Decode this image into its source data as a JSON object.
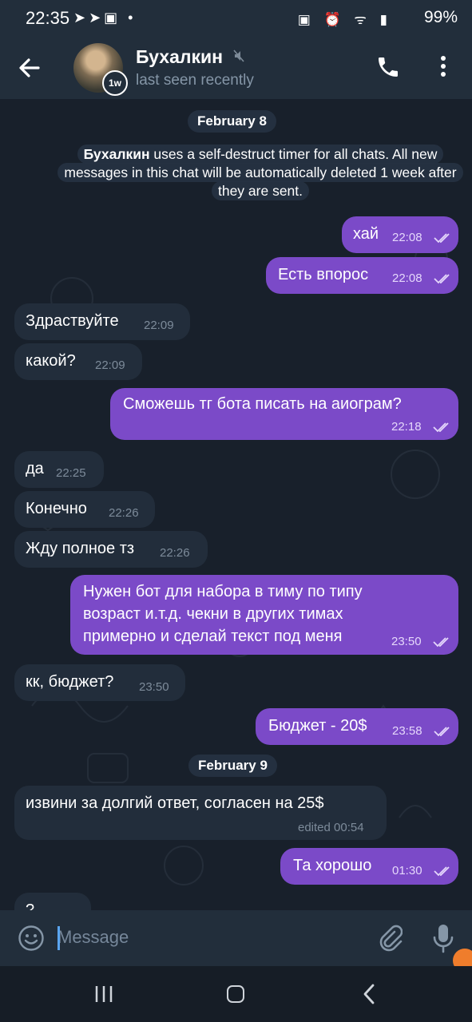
{
  "status_bar": {
    "time": "22:35",
    "battery": "99%",
    "left_icons": "➤➤▣ •",
    "right_icons": "▣ ⏰ ᯤ ▮"
  },
  "header": {
    "title": "Бухалкин",
    "subtitle": "last seen recently",
    "timer_badge": "1w"
  },
  "chat": {
    "date_1": "February 8",
    "service_name": "Бухалкин",
    "service_text": " uses a self-destruct timer for all chats. All new messages in this chat will be automatically deleted 1 week after they are sent.",
    "date_2": "February 9",
    "messages": [
      {
        "dir": "out",
        "text": "хай",
        "time": "22:08"
      },
      {
        "dir": "out",
        "text": "Есть впорос",
        "time": "22:08"
      },
      {
        "dir": "in",
        "text": "Здраствуйте",
        "time": "22:09"
      },
      {
        "dir": "in",
        "text": "какой?",
        "time": "22:09"
      },
      {
        "dir": "out",
        "text": "Сможешь тг бота писать на аиограм?",
        "time": "22:18"
      },
      {
        "dir": "in",
        "text": "да",
        "time": "22:25"
      },
      {
        "dir": "in",
        "text": "Конечно",
        "time": "22:26"
      },
      {
        "dir": "in",
        "text": "Жду полное тз",
        "time": "22:26"
      },
      {
        "dir": "out",
        "lines": [
          "Нужен бот для набора в тиму по типу",
          "возраст и.т.д. чекни в других тимах",
          "примерно и сделай текст под меня"
        ],
        "time": "23:50"
      },
      {
        "dir": "in",
        "text": "кк, бюджет?",
        "time": "23:50"
      },
      {
        "dir": "out",
        "text": "Бюджет - 20$",
        "time": "23:58"
      },
      {
        "dir": "in",
        "text": "извини за долгий ответ, согласен на 25$",
        "time": "edited 00:54"
      },
      {
        "dir": "out",
        "text": "Та хорошо",
        "time": "01:30"
      },
      {
        "dir": "in",
        "text": "?",
        "time": ""
      }
    ]
  },
  "input": {
    "placeholder": "Message"
  },
  "colors": {
    "outgoing_bubble": "#7b4ac8",
    "incoming_bubble": "#222d3b",
    "background": "#18202b",
    "accent": "#5aa5f0"
  }
}
